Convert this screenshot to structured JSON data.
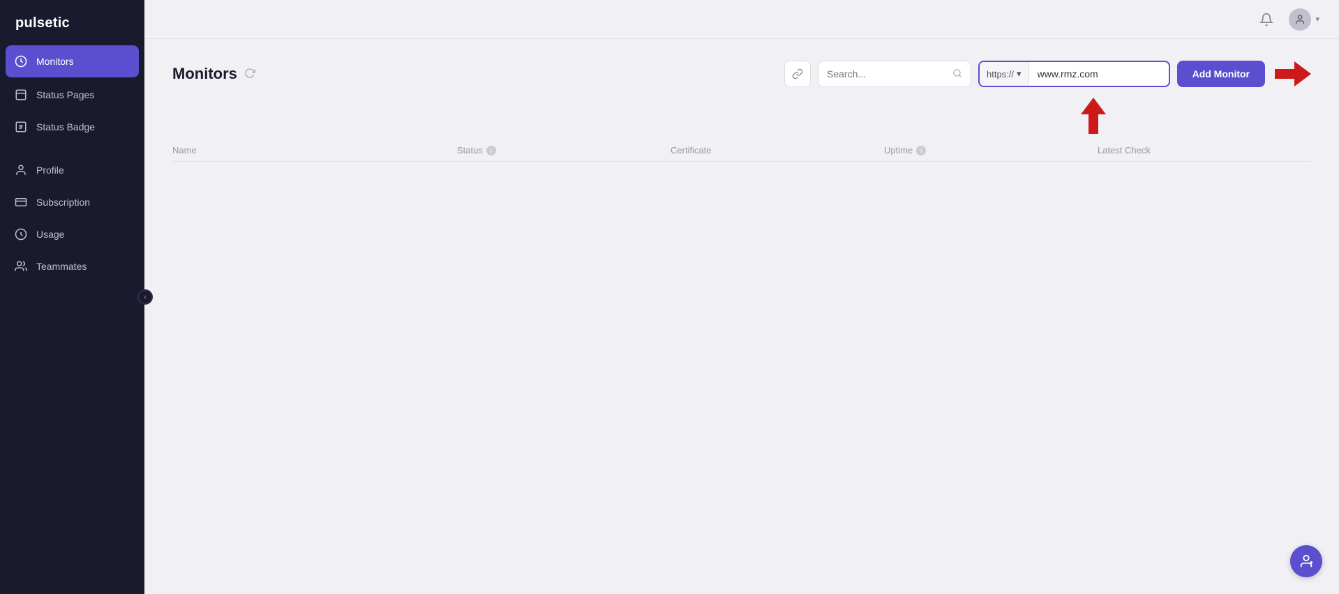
{
  "app": {
    "name": "pulsetic"
  },
  "sidebar": {
    "items": [
      {
        "id": "monitors",
        "label": "Monitors",
        "icon": "monitor-icon",
        "active": true
      },
      {
        "id": "status-pages",
        "label": "Status Pages",
        "icon": "status-pages-icon",
        "active": false
      },
      {
        "id": "status-badge",
        "label": "Status Badge",
        "icon": "status-badge-icon",
        "active": false
      }
    ],
    "bottom_items": [
      {
        "id": "profile",
        "label": "Profile",
        "icon": "profile-icon"
      },
      {
        "id": "subscription",
        "label": "Subscription",
        "icon": "subscription-icon"
      },
      {
        "id": "usage",
        "label": "Usage",
        "icon": "usage-icon"
      },
      {
        "id": "teammates",
        "label": "Teammates",
        "icon": "teammates-icon"
      }
    ]
  },
  "topbar": {
    "bell_title": "Notifications",
    "user_chevron": "▾"
  },
  "monitors": {
    "title": "Monitors",
    "refresh_title": "Refresh",
    "search_placeholder": "Search...",
    "url_protocol": "https://",
    "url_value": "www.rmz.com",
    "add_button_label": "Add Monitor",
    "table_columns": [
      {
        "id": "name",
        "label": "Name",
        "has_info": false
      },
      {
        "id": "status",
        "label": "Status",
        "has_info": true
      },
      {
        "id": "certificate",
        "label": "Certificate",
        "has_info": false
      },
      {
        "id": "uptime",
        "label": "Uptime",
        "has_info": true
      },
      {
        "id": "latest_check",
        "label": "Latest Check",
        "has_info": false
      }
    ]
  },
  "colors": {
    "sidebar_bg": "#1a1a2e",
    "active_bg": "#5b4fcf",
    "button_bg": "#5b4fcf"
  }
}
